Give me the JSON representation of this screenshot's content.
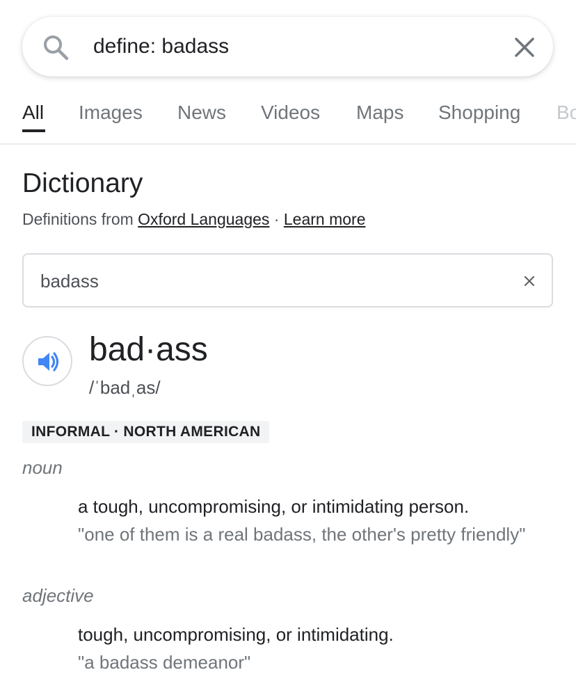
{
  "search": {
    "query": "define: badass",
    "icon": "search-icon",
    "clear_icon": "close-icon"
  },
  "tabs": [
    {
      "label": "All",
      "active": true
    },
    {
      "label": "Images"
    },
    {
      "label": "News"
    },
    {
      "label": "Videos"
    },
    {
      "label": "Maps"
    },
    {
      "label": "Shopping"
    },
    {
      "label": "Bo"
    }
  ],
  "dictionary": {
    "title": "Dictionary",
    "source_prefix": "Definitions from ",
    "source_link": "Oxford Languages",
    "separator": " · ",
    "learn_more": "Learn more",
    "input_value": "badass",
    "headword": "bad·ass",
    "phonetic": "/ˈbadˌas/",
    "label": "INFORMAL · NORTH AMERICAN",
    "entries": [
      {
        "pos": "noun",
        "definition": "a tough, uncompromising, or intimidating person.",
        "example": "\"one of them is a real badass, the other's pretty friendly\""
      },
      {
        "pos": "adjective",
        "definition": "tough, uncompromising, or intimidating.",
        "example": "\"a badass demeanor\""
      }
    ]
  },
  "colors": {
    "accent_blue": "#4285f4",
    "text_primary": "#202124",
    "text_secondary": "#70757a"
  }
}
